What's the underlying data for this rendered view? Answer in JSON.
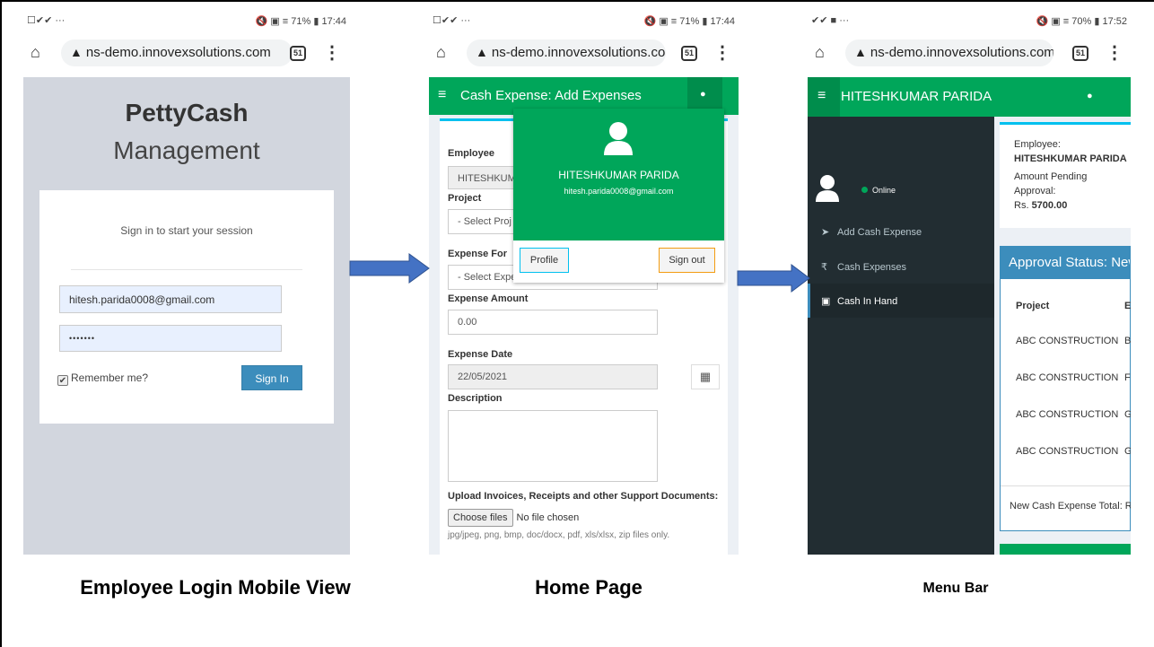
{
  "panels": [
    {
      "statusbar": {
        "left": "☐✔✔ ···",
        "right": "🔇 ▣ ≡ 71% ▮ 17:44"
      },
      "url": "ns-demo.innovexsolutions.com",
      "tabs_count": "51",
      "caption": "Employee Login Mobile View"
    },
    {
      "statusbar": {
        "left": "☐✔✔ ···",
        "right": "🔇 ▣ ≡ 71% ▮ 17:44"
      },
      "url": "ns-demo.innovexsolutions.com",
      "tabs_count": "51",
      "caption": "Home Page"
    },
    {
      "statusbar": {
        "left": "✔✔ ■ ···",
        "right": "🔇 ▣ ≡ 70% ▮ 17:52"
      },
      "url": "ns-demo.innovexsolutions.com",
      "tabs_count": "51",
      "caption": "Menu Bar"
    }
  ],
  "login": {
    "brand_bold": "PettyCash",
    "brand_light": "Management",
    "message": "Sign in to start your session",
    "email_value": "hitesh.parida0008@gmail.com",
    "password_value": "•••••••",
    "remember_label": "Remember me?",
    "signin_label": "Sign In"
  },
  "home": {
    "header_title": "Cash Expense: Add Expenses",
    "employee_label": "Employee",
    "employee_value": "HITESHKUM",
    "project_label": "Project",
    "project_placeholder": "- Select Proj",
    "expense_for_label": "Expense For",
    "expense_for_placeholder": "- Select Expe",
    "amount_label": "Expense Amount",
    "amount_value": "0.00",
    "date_label": "Expense Date",
    "date_value": "22/05/2021",
    "description_label": "Description",
    "upload_label": "Upload Invoices, Receipts and other Support Documents:",
    "choose_files": "Choose files",
    "no_file": "No file chosen",
    "file_hint": "jpg/jpeg, png, bmp, doc/docx, pdf, xls/xlsx, zip files only.",
    "user_menu": {
      "name": "HITESHKUMAR PARIDA",
      "email": "hitesh.parida0008@gmail.com",
      "profile_label": "Profile",
      "signout_label": "Sign out"
    }
  },
  "menu": {
    "header_name": "HITESHKUMAR PARIDA",
    "online_label": "Online",
    "items": [
      {
        "label": "Add Cash Expense",
        "icon": "paper-plane-icon"
      },
      {
        "label": "Cash Expenses",
        "icon": "rupee-icon"
      },
      {
        "label": "Cash In Hand",
        "icon": "money-icon"
      }
    ],
    "active_item": "Cash In Hand",
    "info": {
      "employee_label": "Employee:",
      "employee_name": "HITESHKUMAR PARIDA",
      "pending_line1": "Amount Pending",
      "pending_line2": "Approval:",
      "amount_prefix": "Rs.",
      "amount_value": "5700.00"
    },
    "approval": {
      "title": "Approval Status: New",
      "col_project": "Project",
      "col_second": "E",
      "rows": [
        {
          "project": "ABC CONSTRUCTION",
          "second": "B"
        },
        {
          "project": "ABC CONSTRUCTION",
          "second": "F"
        },
        {
          "project": "ABC CONSTRUCTION",
          "second": "G"
        },
        {
          "project": "ABC CONSTRUCTION",
          "second": "G"
        }
      ],
      "total_label": "New Cash Expense Total: R"
    }
  },
  "colors": {
    "green": "#00a65a",
    "blue": "#3c8dbc",
    "login_bg": "#d2d6de",
    "sidebar": "#222d32",
    "arrow": "#4472c4"
  }
}
